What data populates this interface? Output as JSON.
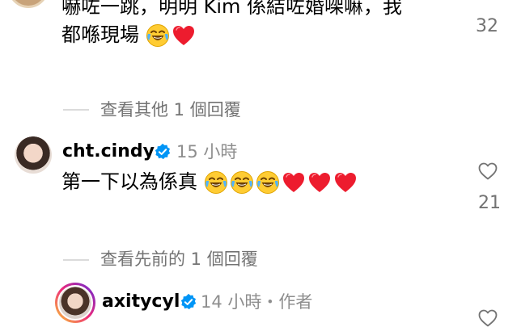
{
  "comment_top": {
    "line1": "嚇咗一跳，明明 Kim 係結咗婚㗎嘛，我",
    "line2": "都喺現場",
    "emojis": [
      "laugh-cry-emoji",
      "red-heart-emoji"
    ],
    "like_count": "32"
  },
  "view_other_replies": "查看其他 1 個回覆",
  "comment_cindy": {
    "username": "cht.cindy",
    "time": "15 小時",
    "text": "第一下以為係真",
    "emojis": [
      "laugh-cry-emoji",
      "laugh-cry-emoji",
      "laugh-cry-emoji",
      "red-heart-emoji",
      "red-heart-emoji",
      "red-heart-emoji"
    ],
    "like_count": "21"
  },
  "view_previous_replies": "查看先前的 1 個回覆",
  "comment_axity": {
    "username": "axitycyl",
    "time": "14 小時・作者"
  },
  "colors": {
    "verified_blue": "#0095f6",
    "secondary_text": "#737373",
    "heart_red": "#ed1c2e",
    "story_ring_start": "#f9ce34",
    "story_ring_end": "#ee2a7b"
  }
}
